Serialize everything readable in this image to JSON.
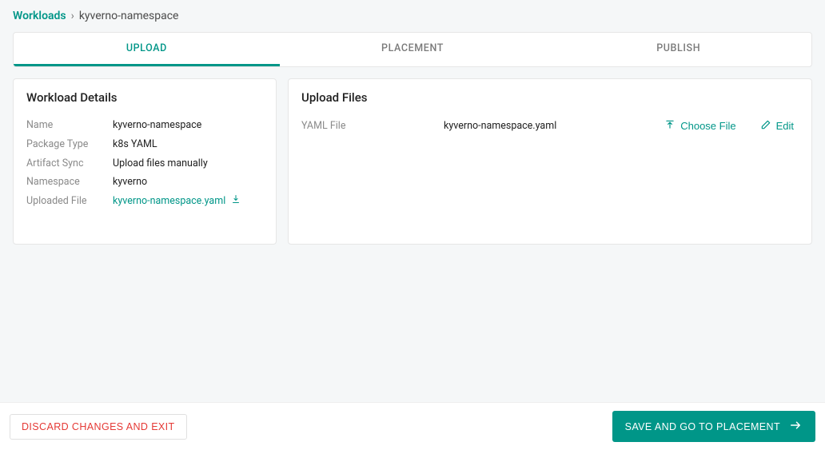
{
  "breadcrumb": {
    "root": "Workloads",
    "separator": "›",
    "current": "kyverno-namespace"
  },
  "tabs": {
    "upload": "UPLOAD",
    "placement": "PLACEMENT",
    "publish": "PUBLISH"
  },
  "details": {
    "title": "Workload Details",
    "rows": {
      "name_label": "Name",
      "name_value": "kyverno-namespace",
      "package_label": "Package Type",
      "package_value": "k8s YAML",
      "artifact_label": "Artifact Sync",
      "artifact_value": "Upload files manually",
      "namespace_label": "Namespace",
      "namespace_value": "kyverno",
      "uploaded_label": "Uploaded File",
      "uploaded_value": "kyverno-namespace.yaml"
    }
  },
  "upload": {
    "title": "Upload Files",
    "yaml_label": "YAML File",
    "yaml_value": "kyverno-namespace.yaml",
    "choose_label": "Choose File",
    "edit_label": "Edit"
  },
  "footer": {
    "discard": "DISCARD CHANGES AND EXIT",
    "save": "SAVE AND GO TO PLACEMENT"
  }
}
